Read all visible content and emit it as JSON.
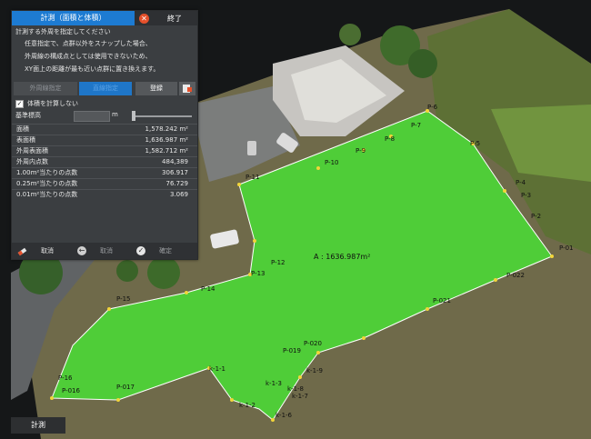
{
  "panel": {
    "title": "計測（面積と体積）",
    "close_label": "終了",
    "instructions": [
      "計測する外周を指定してください",
      "任意指定で、点群以外をスナップした場合、",
      "外周線の構成点としては使用できないため、",
      "XY面上の距離が最も近い点群に置き換えます。"
    ],
    "buttons": {
      "perimeter": "外周線指定",
      "draw": "直線指定",
      "register": "登録"
    },
    "no_volume_label": "体積を計算しない",
    "base_elevation_label": "基準標高",
    "base_elevation_unit": "m",
    "base_elevation_value": "",
    "stats": [
      {
        "label": "面積",
        "value": "1,578.242 m²"
      },
      {
        "label": "表面積",
        "value": "1,636.987 m²"
      },
      {
        "label": "外周表面積",
        "value": "1,582.712 m²"
      },
      {
        "label": "外周内点数",
        "value": "484,389"
      },
      {
        "label": "1.00m²当たりの点数",
        "value": "306.917"
      },
      {
        "label": "0.25m²当たりの点数",
        "value": "76.729"
      },
      {
        "label": "0.01m²当たりの点数",
        "value": "3.069"
      }
    ],
    "footer": {
      "cancel": "取消",
      "undo": "取消",
      "confirm": "確定"
    }
  },
  "bottom_tab": "計測",
  "map": {
    "area_label": "A : 1636.987m²",
    "points": [
      "P-6",
      "P-7",
      "P-5",
      "P-4",
      "P-3",
      "P-2",
      "P-01",
      "P-022",
      "P-021",
      "P-020",
      "P-019",
      "P-016",
      "P-017",
      "P-16",
      "P-15",
      "P-14",
      "P-13",
      "P-12",
      "P-11",
      "P-10",
      "P-9",
      "P-8",
      "k-1-1",
      "k-1-2",
      "k-1-3",
      "k-1-6",
      "k-1-7",
      "k-1-8",
      "k-1-9"
    ]
  },
  "colors": {
    "accent": "#1d7bd2",
    "polygon_fill": "#4cd636",
    "polygon_edge": "#ffffff",
    "vertex": "#f2d53a"
  }
}
